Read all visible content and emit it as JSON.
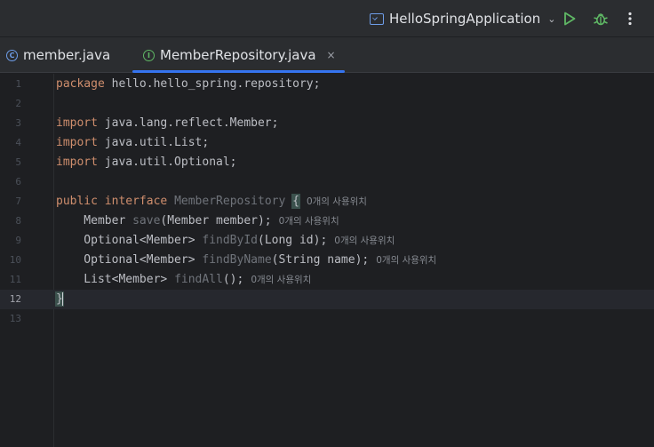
{
  "toolbar": {
    "run_config_label": "HelloSpringApplication",
    "run_icon_color": "#5fb865",
    "debug_icon_color": "#5fb865"
  },
  "tabs": [
    {
      "label": "member.java",
      "icon": "class-icon",
      "icon_letter": "C",
      "active": false
    },
    {
      "label": "MemberRepository.java",
      "icon": "interface-icon",
      "icon_letter": "I",
      "active": true,
      "close": "×"
    }
  ],
  "editor": {
    "current_line": 12,
    "lines": [
      {
        "n": "1"
      },
      {
        "n": "2"
      },
      {
        "n": "3"
      },
      {
        "n": "4"
      },
      {
        "n": "5"
      },
      {
        "n": "6"
      },
      {
        "n": "7"
      },
      {
        "n": "8"
      },
      {
        "n": "9"
      },
      {
        "n": "10"
      },
      {
        "n": "11"
      },
      {
        "n": "12"
      },
      {
        "n": "13"
      }
    ],
    "tokens": {
      "l1_kw": "package",
      "l1_rest": " hello.hello_spring.repository;",
      "l3_kw": "import",
      "l3_rest": " java.lang.reflect.Member;",
      "l4_kw": "import",
      "l4_rest": " java.util.List;",
      "l5_kw": "import",
      "l5_rest": " java.util.Optional;",
      "l7_kw1": "public",
      "l7_kw2": "interface",
      "l7_name": "MemberRepository",
      "l7_brace": "{",
      "l8_type": "    Member ",
      "l8_fn": "save",
      "l8_rest": "(Member member);",
      "l9_type": "    Optional<Member> ",
      "l9_fn": "findById",
      "l9_rest": "(Long id);",
      "l10_type": "    Optional<Member> ",
      "l10_fn": "findByName",
      "l10_rest": "(String name);",
      "l11_type": "    List<Member> ",
      "l11_fn": "findAll",
      "l11_rest": "();",
      "l12_brace": "}"
    },
    "usage_hint": "0개의 사용위치"
  }
}
